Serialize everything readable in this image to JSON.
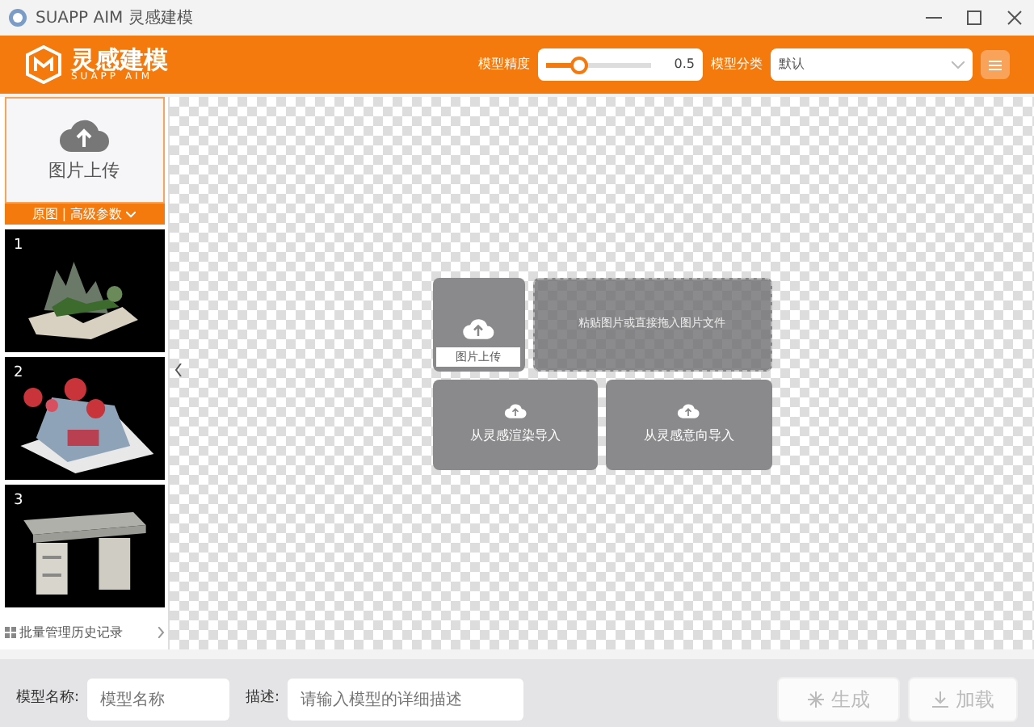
{
  "window": {
    "title": "SUAPP AIM 灵感建模"
  },
  "header": {
    "logo_title": "灵感建模",
    "logo_subtitle": "SUAPP AIM",
    "precision_label": "模型精度",
    "precision": {
      "level": 0.3
    },
    "precision_value": "0.5",
    "category_label": "模型分类",
    "category_value": "默认"
  },
  "sidebar": {
    "upload_label": "图片上传",
    "options_label": "原图 | 高级参数",
    "thumbnails": [
      {
        "number": "1",
        "kind": "picture"
      },
      {
        "number": "2",
        "kind": "picture"
      },
      {
        "number": "3",
        "kind": "picture"
      }
    ],
    "history_label": "批量管理历史记录"
  },
  "canvas": {
    "upload_label": "图片上传",
    "paste_hint": "粘贴图片或直接拖入图片文件",
    "import_buttons": [
      "从灵感渲染导入",
      "从灵感意向导入"
    ]
  },
  "footer": {
    "name_label": "模型名称:",
    "name_placeholder": "模型名称",
    "desc_label": "描述:",
    "desc_placeholder": "请输入模型的详细描述",
    "buttons": [
      "生成",
      "加载"
    ]
  }
}
